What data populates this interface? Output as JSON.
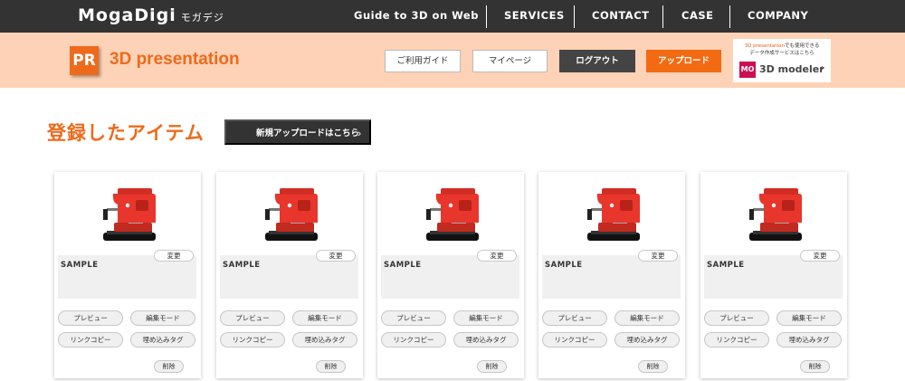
{
  "brand": {
    "name": "MogaDigi",
    "kana": "モガデジ"
  },
  "nav": [
    {
      "label": "Guide to 3D on Web"
    },
    {
      "label": "SERVICES"
    },
    {
      "label": "CONTACT"
    },
    {
      "label": "CASE"
    },
    {
      "label": "COMPANY"
    }
  ],
  "header": {
    "logo_text": "PR",
    "title": "3D presentation",
    "buttons": {
      "guide": "ご利用ガイド",
      "mypage": "マイページ",
      "logout": "ログアウト",
      "upload": "アップロード"
    },
    "promo": {
      "highlight": "3D presentation",
      "line1_rest": "でも使用できる",
      "line2": "データ作成サービスはこちら",
      "logo_text": "MO",
      "product": "3D modeler",
      "chevron": "›"
    }
  },
  "section": {
    "title": "登録したアイテム",
    "new_upload_label": "新規アップロードはこちら",
    "new_upload_chevron": "›"
  },
  "cards": [
    {
      "change": "変更",
      "name": "SAMPLE",
      "preview": "プレビュー",
      "edit": "編集モード",
      "copy_link": "リンクコピー",
      "embed_tag": "埋め込みタグ",
      "delete": "削除"
    },
    {
      "change": "変更",
      "name": "SAMPLE",
      "preview": "プレビュー",
      "edit": "編集モード",
      "copy_link": "リンクコピー",
      "embed_tag": "埋め込みタグ",
      "delete": "削除"
    },
    {
      "change": "変更",
      "name": "SAMPLE",
      "preview": "プレビュー",
      "edit": "編集モード",
      "copy_link": "リンクコピー",
      "embed_tag": "埋め込みタグ",
      "delete": "削除"
    },
    {
      "change": "変更",
      "name": "SAMPLE",
      "preview": "プレビュー",
      "edit": "編集モード",
      "copy_link": "リンクコピー",
      "embed_tag": "埋め込みタグ",
      "delete": "削除"
    },
    {
      "change": "変更",
      "name": "SAMPLE",
      "preview": "プレビュー",
      "edit": "編集モード",
      "copy_link": "リンクコピー",
      "embed_tag": "埋め込みタグ",
      "delete": "削除"
    }
  ],
  "colors": {
    "accent_orange": "#ee6a1b",
    "nav_dark": "#333333",
    "band_peach": "#fdd2b6",
    "modeler_magenta": "#cc0f52",
    "product_red": "#e8362c"
  },
  "icons": {
    "product_thumbnail": "espresso-machine-icon",
    "chevron": "chevron-right-icon"
  }
}
